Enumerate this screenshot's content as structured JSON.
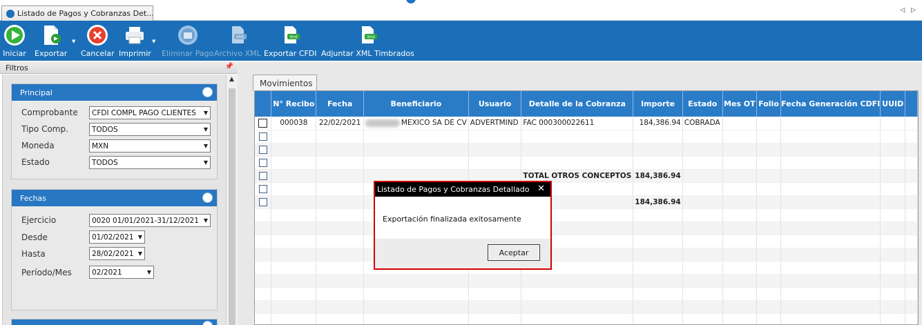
{
  "tab": {
    "title": "Listado de Pagos y Cobranzas Det...",
    "nav": "◁ ▷"
  },
  "toolbar": {
    "iniciar": "Iniciar",
    "exportar": "Exportar",
    "cancelar": "Cancelar",
    "imprimir": "Imprimir",
    "eliminar_pago": "Eliminar Pago",
    "archivo_xml": "Archivo XML",
    "exportar_cfdi": "Exportar CFDI",
    "adjuntar_xml": "Adjuntar XML Timbrados",
    "xml_badge": "Xml",
    "xml_badge2": "XML"
  },
  "filters": {
    "title": "Filtros",
    "principal": {
      "title": "Principal",
      "comprobante_label": "Comprobante",
      "comprobante_value": "CFDI COMPL PAGO CLIENTES",
      "tipo_label": "Tipo Comp.",
      "tipo_value": "TODOS",
      "moneda_label": "Moneda",
      "moneda_value": "MXN",
      "estado_label": "Estado",
      "estado_value": "TODOS"
    },
    "fechas": {
      "title": "Fechas",
      "ejercicio_label": "Ejercicio",
      "ejercicio_value": "0020 01/01/2021-31/12/2021",
      "desde_label": "Desde",
      "desde_value": "01/02/2021",
      "hasta_label": "Hasta",
      "hasta_value": "28/02/2021",
      "periodo_label": "Período/Mes",
      "periodo_value": "02/2021"
    }
  },
  "movimientos": {
    "tab_label": "Movimientos",
    "columns": [
      "N° Recibo",
      "Fecha",
      "Beneficiario",
      "Usuario",
      "Detalle de la Cobranza",
      "Importe",
      "Estado",
      "Mes OT",
      "Folio",
      "Fecha Generación CDFI",
      "UUID"
    ],
    "row1": {
      "recibo": "000038",
      "fecha": "22/02/2021",
      "beneficiario": "MEXICO SA DE CV",
      "usuario": "ADVERTMIND",
      "detalle": "FAC 000300022611",
      "importe": "184,386.94",
      "estado": "COBRADA"
    },
    "total_label": "TOTAL OTROS CONCEPTOS",
    "total_value": "184,386.94",
    "grand_total": "184,386.94"
  },
  "dialog": {
    "title": "Listado de Pagos y Cobranzas Detallado",
    "close": "✕",
    "message": "Exportación finalizada exitosamente",
    "ok": "Aceptar"
  }
}
